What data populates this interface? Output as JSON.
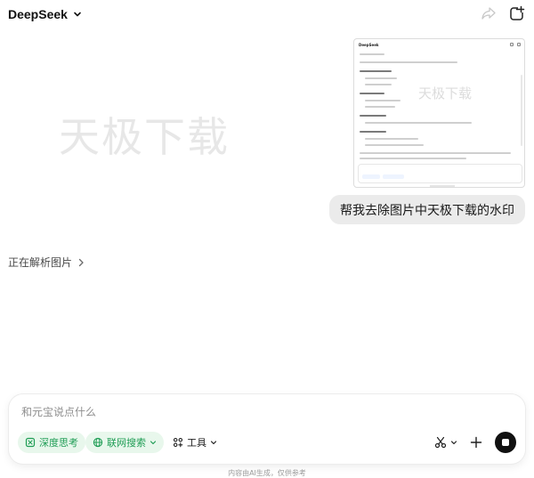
{
  "header": {
    "app_name": "DeepSeek",
    "share_icon": "share-icon",
    "new_chat_icon": "new-chat-icon"
  },
  "watermark_text": "天极下载",
  "thumbnail": {
    "app_name": "DeepSeek",
    "watermark": "天极下载"
  },
  "user_message": "帮我去除图片中天极下载的水印",
  "status": {
    "label": "正在解析图片",
    "icon": "chevron-right-icon"
  },
  "input": {
    "placeholder": "和元宝说点什么",
    "deep_think_label": "深度思考",
    "web_search_label": "联网搜索",
    "tools_label": "工具",
    "colors": {
      "chip_bg": "#e8f7ec",
      "chip_text": "#1f9d55"
    }
  },
  "footer_note": "内容由AI生成，仅供参考"
}
